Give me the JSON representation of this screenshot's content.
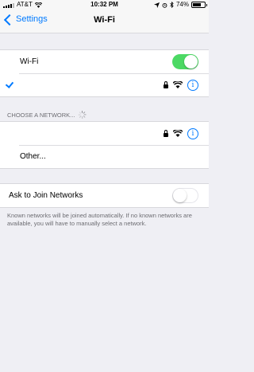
{
  "status_bar": {
    "carrier": "AT&T",
    "time": "10:32 PM",
    "battery": "74%"
  },
  "nav": {
    "back_label": "Settings",
    "title": "Wi-Fi"
  },
  "wifi": {
    "label": "Wi-Fi",
    "enabled": true,
    "connected_network": ""
  },
  "networks": {
    "header": "CHOOSE A NETWORK...",
    "items": [
      {
        "name": ""
      }
    ],
    "other_label": "Other..."
  },
  "ask_to_join": {
    "label": "Ask to Join Networks",
    "enabled": false,
    "footer": "Known networks will be joined automatically. If no known networks are available, you will have to manually select a network."
  },
  "colors": {
    "accent": "#007aff",
    "toggle_on": "#4cd964",
    "background": "#efeff4"
  },
  "icons": [
    "signal-bars-icon",
    "wifi-icon",
    "location-arrow-icon",
    "alarm-icon",
    "bluetooth-icon",
    "battery-icon",
    "chevron-left-icon",
    "checkmark-icon",
    "lock-icon",
    "info-icon",
    "activity-spinner-icon"
  ]
}
